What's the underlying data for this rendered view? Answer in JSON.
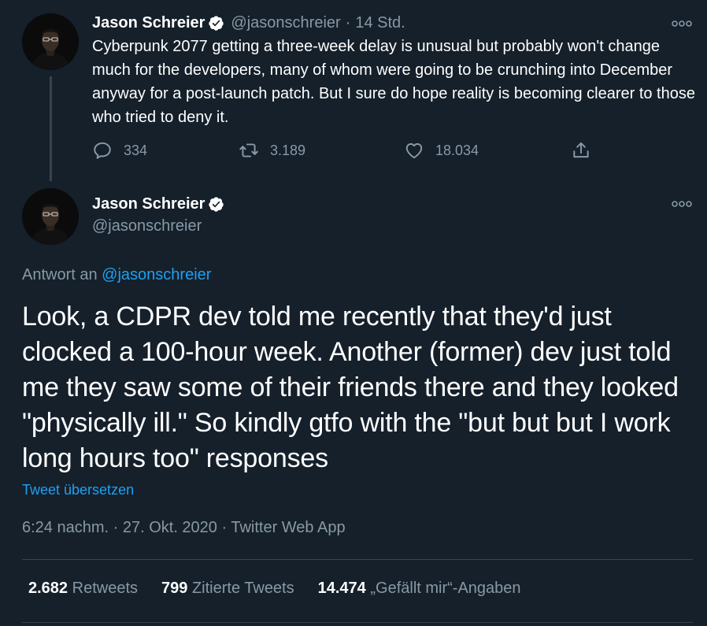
{
  "colors": {
    "background": "#15202b",
    "text_primary": "#ffffff",
    "text_secondary": "#8899a6",
    "accent": "#1da1f2",
    "border": "#38444d"
  },
  "tweet1": {
    "name": "Jason Schreier",
    "handle": "@jasonschreier",
    "separator": "·",
    "time": "14 Std.",
    "text": "Cyberpunk 2077 getting a three-week delay is unusual but probably won't change much for the developers, many of whom were going to be crunching into December anyway for a post-launch patch. But I sure do hope reality is becoming clearer to those who tried to deny it.",
    "actions": {
      "reply_count": "334",
      "retweet_count": "3.189",
      "like_count": "18.034"
    },
    "icons": [
      "reply-icon",
      "retweet-icon",
      "like-icon",
      "share-icon",
      "more-icon",
      "verified-icon"
    ]
  },
  "tweet2": {
    "name": "Jason Schreier",
    "handle": "@jasonschreier",
    "reply_prefix": "Antwort an ",
    "reply_handle": "@jasonschreier",
    "text": "Look, a CDPR dev told me recently that they'd just clocked a 100-hour week. Another (former) dev just told me they saw some of their friends there and they looked \"physically ill.\" So kindly gtfo with the \"but but but I work long hours too\" responses",
    "translate_label": "Tweet übersetzen",
    "meta": "6:24 nachm. · 27. Okt. 2020 · Twitter Web App",
    "stats": {
      "retweets_value": "2.682",
      "retweets_label": "Retweets",
      "quotes_value": "799",
      "quotes_label": "Zitierte Tweets",
      "likes_value": "14.474",
      "likes_label": "„Gefällt mir“-Angaben"
    }
  }
}
